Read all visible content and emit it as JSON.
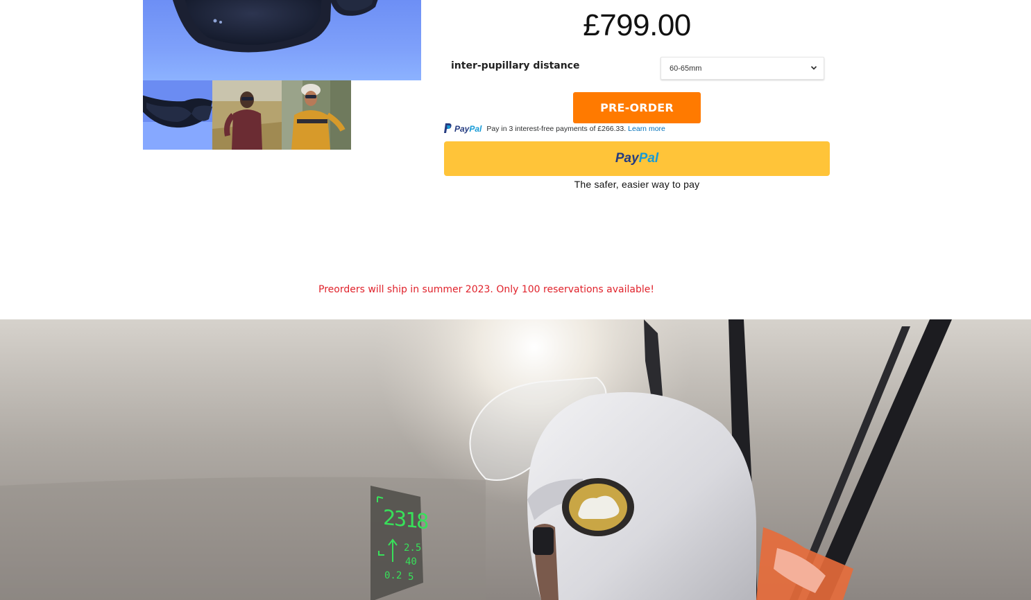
{
  "product": {
    "price": "£799.00",
    "option_label": "inter-pupillary distance",
    "ipd_selected": "60-65mm",
    "preorder_label": "PRE-ORDER"
  },
  "gallery": {
    "thumbs": [
      "sunglasses-product",
      "runner-wearing-glasses",
      "cyclist-wearing-glasses"
    ]
  },
  "paypal": {
    "brand_pay": "Pay",
    "brand_pal": "Pal",
    "paylater_text": "Pay in 3 interest-free payments of £266.33.",
    "learn_more": "Learn more",
    "tagline": "The safer, easier way to pay",
    "button_color": "#ffc439"
  },
  "notice": "Preorders will ship in summer 2023. Only 100 reservations available!",
  "hud": {
    "altitude": "2318",
    "speed": "2.5",
    "value_mid": "40",
    "value_left": "0.2",
    "value_right": "5"
  },
  "colors": {
    "preorder": "#ff7a00",
    "notice": "#e0222b",
    "hud_green": "#38e05a"
  }
}
